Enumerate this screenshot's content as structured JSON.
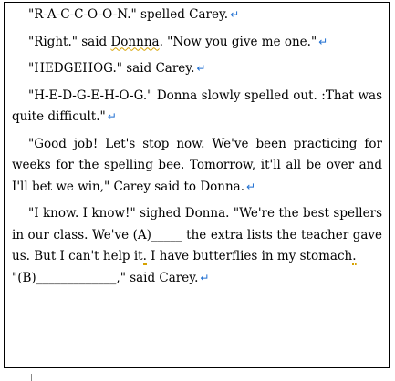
{
  "document": {
    "paragraph_mark": "↵",
    "paragraphs": [
      "\"R-A-C-C-O-O-N.\" spelled Carey.",
      "\"Right.\" said Donnna. \"Now you give me one.\"",
      "\"HEDGEHOG.\" said Carey.",
      "\"H-E-D-G-E-H-O-G.\" Donna slowly spelled out. :That was quite difficult.\"",
      "\"Good job! Let's stop now. We've been practicing for weeks for the spelling bee. Tomorrow, it'll all be over and I'll bet we win,\" Carey said to Donna.",
      "\"I know. I know!\" sighed Donna. \"We're the best spellers in our class. We've (A)_____ the extra lists the teacher gave us. But I can't help it.",
      "I have butterflies in my stomach.",
      "\"(B)_____________,\" said Carey."
    ],
    "p2": {
      "before": "\"Right.\" said ",
      "flagged": "Donnna",
      "after": ". \"Now you give me one.\""
    },
    "p6": {
      "text": "\"I know. I know!\" sighed Donna. \"We're the best spellers in our class. We've (A)_____ the extra lists the teacher gave us. But I can't help it",
      "flagged": "."
    },
    "p7": {
      "text": "I have butterflies in my stomach",
      "flagged": "."
    },
    "p8": "\"(B)_____________,\" said Carey."
  }
}
